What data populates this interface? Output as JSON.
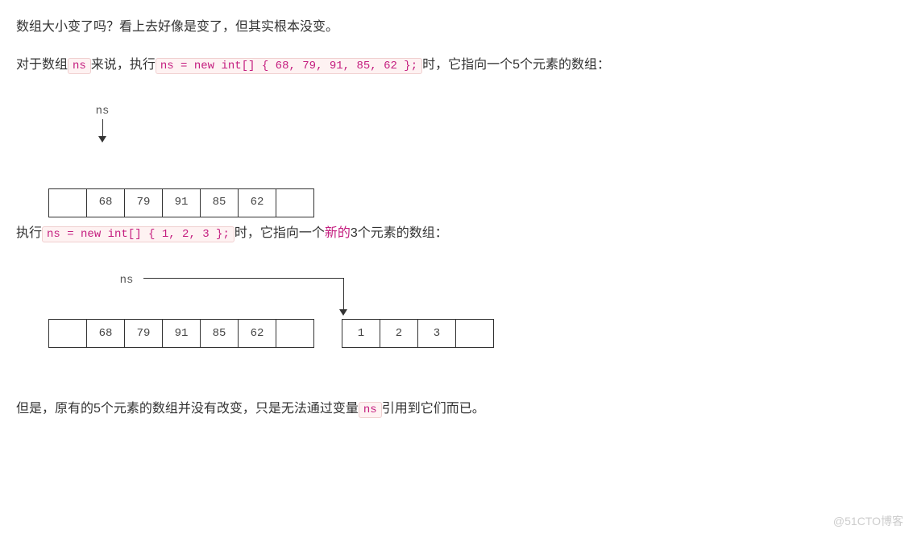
{
  "p1": "数组大小变了吗？看上去好像是变了，但其实根本没变。",
  "p2_a": "对于数组",
  "p2_code1": "ns",
  "p2_b": "来说，执行",
  "p2_code2": "ns = new int[] { 68, 79, 91, 85, 62 };",
  "p2_c": "时，它指向一个5个元素的数组：",
  "diag1": {
    "label": "ns",
    "cells": [
      "",
      "68",
      "79",
      "91",
      "85",
      "62",
      ""
    ]
  },
  "p3_a": "执行",
  "p3_code1": "ns = new int[] { 1, 2, 3 };",
  "p3_b": "时，它指向一个",
  "p3_emph": "新的",
  "p3_c": "3个元素的数组：",
  "diag2": {
    "label": "ns",
    "cells_left": [
      "",
      "68",
      "79",
      "91",
      "85",
      "62",
      ""
    ],
    "cells_right": [
      "1",
      "2",
      "3",
      ""
    ]
  },
  "p4_a": "但是，原有的5个元素的数组并没有改变，只是无法通过变量",
  "p4_code1": "ns",
  "p4_b": "引用到它们而已。",
  "watermark": "@51CTO博客"
}
